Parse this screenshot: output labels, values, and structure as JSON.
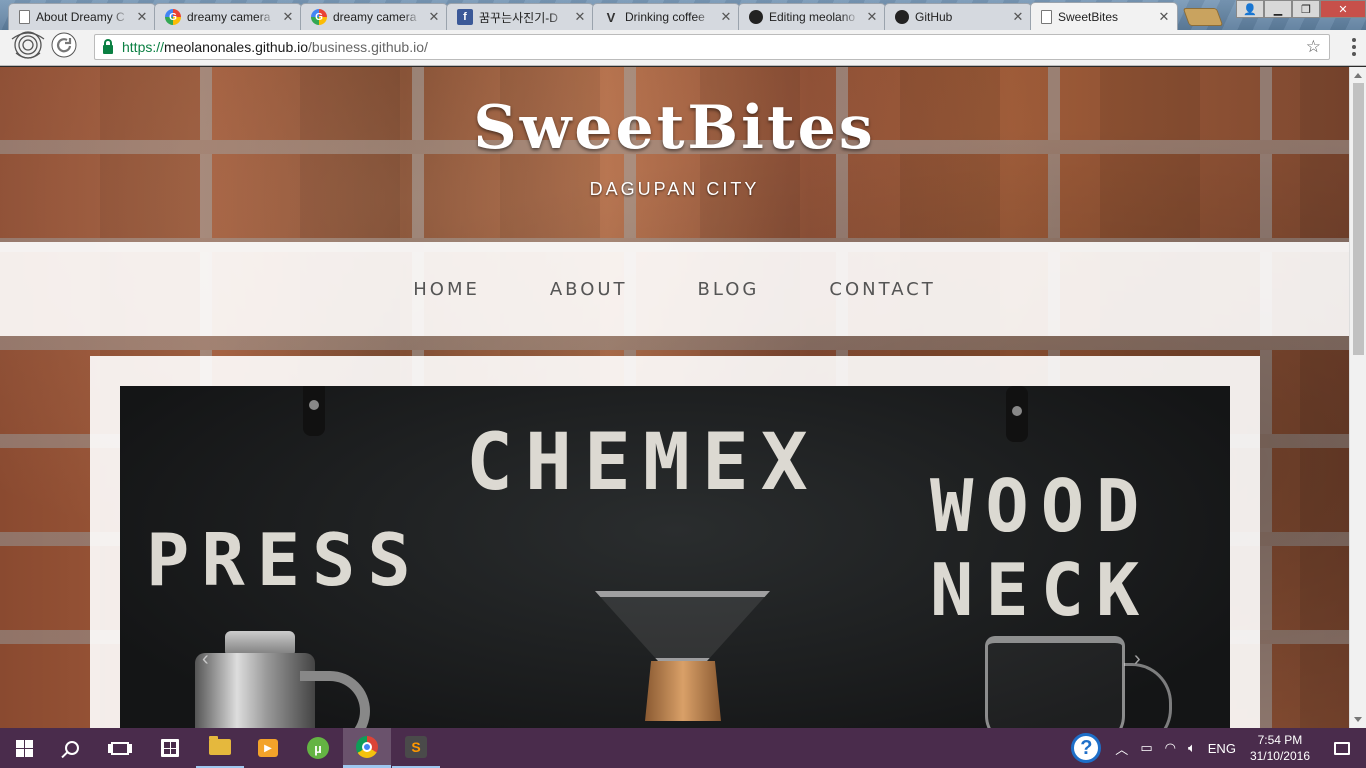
{
  "browser": {
    "tabs": [
      {
        "title": "About Dreamy C",
        "icon": "document-icon",
        "active": false
      },
      {
        "title": "dreamy camera",
        "icon": "google-icon",
        "active": false
      },
      {
        "title": "dreamy camera",
        "icon": "google-icon",
        "active": false
      },
      {
        "title": "꿈꾸는사진기-D",
        "icon": "facebook-icon",
        "active": false
      },
      {
        "title": "Drinking coffee",
        "icon": "vsco-icon",
        "active": false
      },
      {
        "title": "Editing meolano",
        "icon": "github-icon",
        "active": false
      },
      {
        "title": "GitHub",
        "icon": "github-icon",
        "active": false
      },
      {
        "title": "SweetBites",
        "icon": "document-icon",
        "active": true
      }
    ],
    "url": {
      "protocol": "https://",
      "host": "meolanonales.github.io",
      "path": "/business.github.io/"
    }
  },
  "site": {
    "brand": "SweetBites",
    "location": "DAGUPAN CITY",
    "nav": [
      "HOME",
      "ABOUT",
      "BLOG",
      "CONTACT"
    ],
    "slide_text": {
      "chemex": "CHEMEX",
      "press": "PRESS",
      "wood": "WOOD",
      "neck": "NECK"
    },
    "prev_label": "‹",
    "next_label": "›"
  },
  "taskbar": {
    "language": "ENG",
    "time": "7:54 PM",
    "date": "31/10/2016"
  },
  "colors": {
    "taskbar": "#4a2c4c",
    "ssl_green": "#0b8043"
  }
}
